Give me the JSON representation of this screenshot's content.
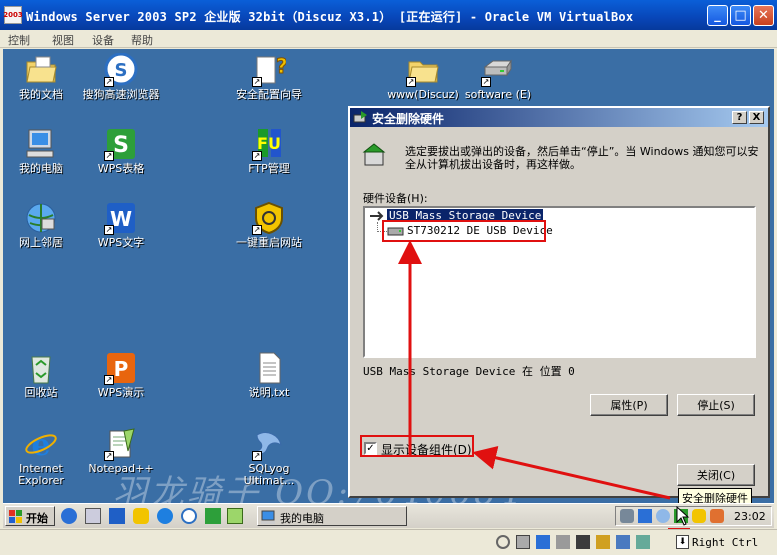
{
  "window": {
    "title": "Windows Server 2003 SP2 企业版 32bit（Discuz X3.1） [正在运行] - Oracle VM VirtualBox",
    "logo_text": "2003"
  },
  "menu": [
    "控制",
    "视图",
    "设备",
    "帮助"
  ],
  "desktop_icons": [
    {
      "label": "我的文档",
      "icon": "folder-icon"
    },
    {
      "label": "搜狗高速浏览器",
      "icon": "sogou-browser-icon"
    },
    {
      "label": "安全配置向导",
      "icon": "security-wizard-icon"
    },
    {
      "label": "www(Discuz)",
      "icon": "folder-icon"
    },
    {
      "label": "software (E)",
      "icon": "drive-icon"
    },
    {
      "label": "我的电脑",
      "icon": "computer-icon"
    },
    {
      "label": "WPS表格",
      "icon": "wps-spreadsheet-icon"
    },
    {
      "label": "FTP管理",
      "icon": "ftp-icon"
    },
    {
      "label": "网上邻居",
      "icon": "network-icon"
    },
    {
      "label": "WPS文字",
      "icon": "wps-writer-icon"
    },
    {
      "label": "一键重启网站",
      "icon": "restart-site-icon"
    },
    {
      "label": "回收站",
      "icon": "recycle-bin-icon"
    },
    {
      "label": "WPS演示",
      "icon": "wps-presentation-icon"
    },
    {
      "label": "说明.txt",
      "icon": "text-file-icon"
    },
    {
      "label": "Internet Explorer",
      "icon": "ie-icon"
    },
    {
      "label": "Notepad++",
      "icon": "notepad-plus-icon"
    },
    {
      "label": "SQLyog Ultimat...",
      "icon": "sqlyog-icon"
    }
  ],
  "dialog": {
    "title": "安全删除硬件",
    "help_btn": "?",
    "close_btn": "X",
    "instruction": "选定要拔出或弹出的设备，然后单击“停止”。当 Windows 通知您可以安全从计算机拔出设备时，再这样做。",
    "list_label": "硬件设备(H):",
    "devices": [
      "USB Mass Storage Device",
      "ST730212 DE USB Device"
    ],
    "status": "USB Mass Storage Device 在 位置 0",
    "properties_btn": "属性(P)",
    "stop_btn": "停止(S)",
    "show_components": "显示设备组件(D)",
    "close_action_btn": "关闭(C)"
  },
  "watermark": "羽龙骑子 QQ:7640684",
  "tooltip": "安全删除硬件",
  "taskbar": {
    "start": "开始",
    "task": "我的电脑",
    "clock": "23:02"
  },
  "statusbar": {
    "host_key": "Right Ctrl"
  },
  "colors": {
    "desktop": "#3a6ea5",
    "highlight": "#e01010",
    "titlebar": "#0a246a"
  }
}
